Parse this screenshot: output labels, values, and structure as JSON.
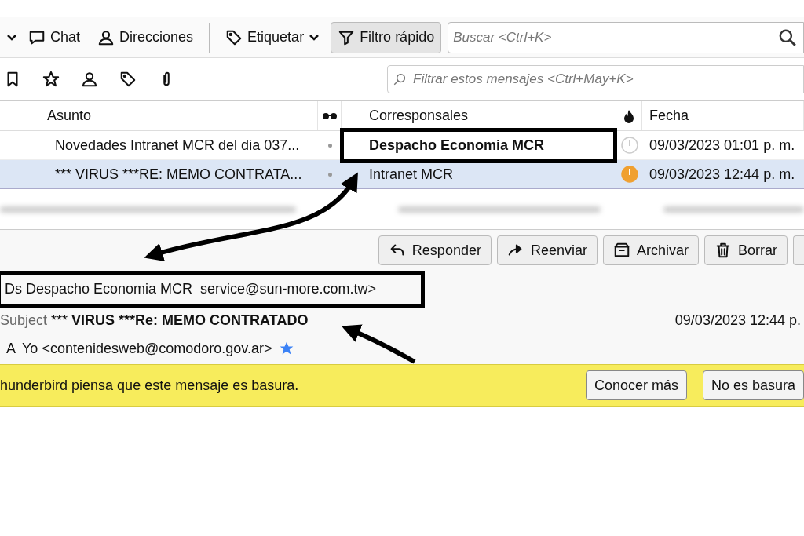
{
  "toolbar": {
    "buttons": [
      {
        "kind": "chat",
        "label": "Chat",
        "dropdown": false,
        "pressed": false
      },
      {
        "kind": "contacts",
        "label": "Direcciones",
        "dropdown": false,
        "pressed": false
      },
      {
        "kind": "tag",
        "label": "Etiquetar",
        "dropdown": true,
        "pressed": false
      },
      {
        "kind": "filter",
        "label": "Filtro rápido",
        "dropdown": false,
        "pressed": true
      }
    ],
    "search": {
      "placeholder": "Buscar <Ctrl+K>"
    }
  },
  "filter_bar": {
    "filter": {
      "placeholder": "Filtrar estos mensajes <Ctrl+May+K>"
    }
  },
  "columns": [
    {
      "kind": "subject",
      "label": "Asunto"
    },
    {
      "kind": "junk"
    },
    {
      "kind": "correspondent",
      "label": "Corresponsales"
    },
    {
      "kind": "flame"
    },
    {
      "kind": "date",
      "label": "Fecha"
    }
  ],
  "messages": [
    {
      "subject": "Novedades Intranet MCR del dia 037...",
      "correspondent": "Despacho Economia MCR",
      "bold": true,
      "date": "09/03/2023 01:01 p. m.",
      "selected": false,
      "junk": false
    },
    {
      "subject": "*** VIRUS ***RE: MEMO CONTRATA...",
      "correspondent": "Intranet MCR",
      "bold": false,
      "date": "09/03/2023 12:44 p. m.",
      "selected": true,
      "junk": true
    }
  ],
  "actions": [
    {
      "kind": "reply",
      "label": "Responder"
    },
    {
      "kind": "forward",
      "label": "Reenviar"
    },
    {
      "kind": "archive",
      "label": "Archivar"
    },
    {
      "kind": "delete",
      "label": "Borrar"
    }
  ],
  "header": {
    "from": "Ds Despacho Economia MCR  service@sun-more.com.tw>",
    "subject_label": "Subject",
    "subject_parts": [
      {
        "text": "***",
        "bold": false
      },
      {
        "text": "VIRUS ***Re: MEMO CONTRATADO",
        "bold": true
      }
    ],
    "date": "09/03/2023 12:44 p.",
    "to_label": "A",
    "to": "Yo <contenidesweb@comodoro.gov.ar>",
    "starred": true
  },
  "junk_bar": {
    "message": "hunderbird piensa que este mensaje es basura.",
    "buttons": [
      "Conocer más",
      "No es basura"
    ]
  }
}
